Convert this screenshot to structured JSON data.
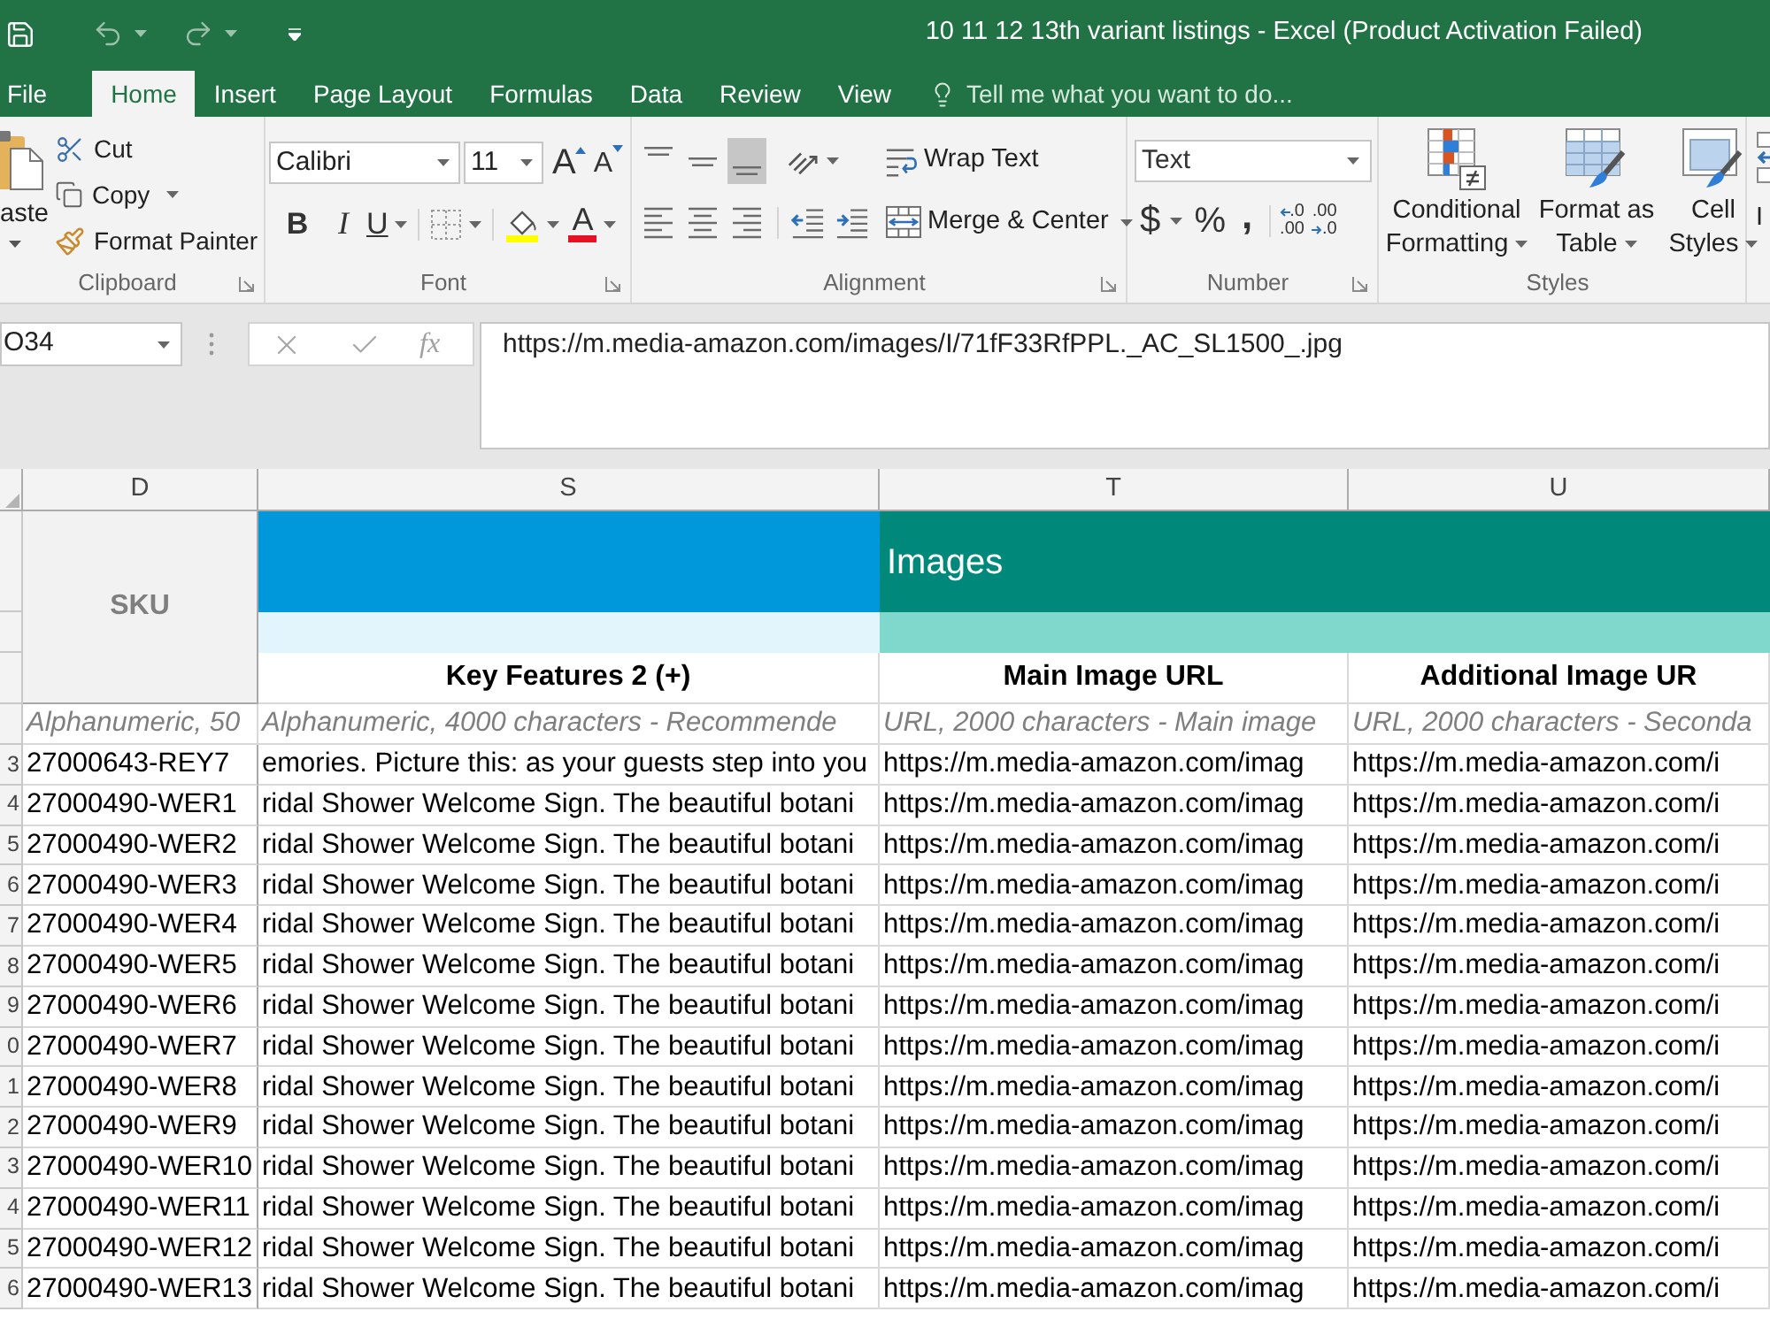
{
  "title_bar": {
    "title": "10 11 12 13th variant listings - Excel (Product Activation Failed)"
  },
  "ribbon_tabs": [
    {
      "label": "File",
      "selected": false
    },
    {
      "label": "Home",
      "selected": true
    },
    {
      "label": "Insert",
      "selected": false
    },
    {
      "label": "Page Layout",
      "selected": false
    },
    {
      "label": "Formulas",
      "selected": false
    },
    {
      "label": "Data",
      "selected": false
    },
    {
      "label": "Review",
      "selected": false
    },
    {
      "label": "View",
      "selected": false
    }
  ],
  "tell_me": {
    "placeholder": "Tell me what you want to do..."
  },
  "ribbon": {
    "clipboard": {
      "label": "Clipboard",
      "paste": "aste",
      "cut": "Cut",
      "copy": "Copy",
      "format_painter": "Format Painter"
    },
    "font": {
      "label": "Font",
      "font_name": "Calibri",
      "font_size": "11",
      "grow": "A",
      "shrink": "A",
      "bold": "B",
      "italic": "I",
      "underline": "U",
      "font_color": "A"
    },
    "alignment": {
      "label": "Alignment",
      "vertical": [
        {
          "kind": "top",
          "selected": false
        },
        {
          "kind": "middle",
          "selected": false
        },
        {
          "kind": "bottom",
          "selected": true
        }
      ],
      "horizontal": [
        {
          "kind": "left",
          "selected": false
        },
        {
          "kind": "center",
          "selected": false
        },
        {
          "kind": "right",
          "selected": false
        }
      ],
      "wrap_text": "Wrap Text",
      "merge_center": "Merge & Center"
    },
    "number": {
      "label": "Number",
      "format": "Text",
      "currency": "$",
      "percent": "%",
      "comma": ",",
      "increase_decimal": [
        ".0",
        ".00"
      ],
      "decrease_decimal": [
        ".00",
        ".0"
      ]
    },
    "styles": {
      "label": "Styles",
      "buttons": [
        {
          "kind": "conditional",
          "label": "Conditional Formatting"
        },
        {
          "kind": "table",
          "label": "Format as Table"
        },
        {
          "kind": "cell",
          "label": "Cell Styles"
        }
      ]
    },
    "cells": {
      "insert": "I"
    }
  },
  "formula_bar": {
    "name_box": "O34",
    "function": "fx",
    "formula": "https://m.media-amazon.com/images/I/71fF33RfPPL._AC_SL1500_.jpg"
  },
  "sheet": {
    "sku_column": {
      "letter": "D",
      "header": "SKU",
      "hint": "Alphanumeric, 50"
    },
    "groups": [
      {
        "color": "#0098da",
        "sub_band": {
          "color": "#e2f4fc"
        },
        "columns": [
          {
            "letter": "S",
            "header": "Key Features 2 (+)",
            "hint": "Alphanumeric, 4000 characters - Recommende"
          }
        ]
      },
      {
        "label": "Images",
        "color": "#00897b",
        "sub_band": {
          "color": "#80d7cc"
        },
        "columns": [
          {
            "letter": "T",
            "header": "Main Image URL",
            "hint": "URL, 2000 characters - Main image"
          },
          {
            "letter": "U",
            "header": "Additional Image UR",
            "hint": "URL, 2000 characters - Seconda"
          }
        ]
      }
    ],
    "rows": [
      {
        "row": "3",
        "cells": [
          "27000643-REY7",
          "emories. Picture this: as your guests step into you",
          "https://m.media-amazon.com/imag",
          "https://m.media-amazon.com/i"
        ]
      },
      {
        "row": "4",
        "cells": [
          "27000490-WER1",
          "ridal Shower Welcome Sign. The beautiful botani",
          "https://m.media-amazon.com/imag",
          "https://m.media-amazon.com/i"
        ]
      },
      {
        "row": "5",
        "cells": [
          "27000490-WER2",
          "ridal Shower Welcome Sign. The beautiful botani",
          "https://m.media-amazon.com/imag",
          "https://m.media-amazon.com/i"
        ]
      },
      {
        "row": "6",
        "cells": [
          "27000490-WER3",
          "ridal Shower Welcome Sign. The beautiful botani",
          "https://m.media-amazon.com/imag",
          "https://m.media-amazon.com/i"
        ]
      },
      {
        "row": "7",
        "cells": [
          "27000490-WER4",
          "ridal Shower Welcome Sign. The beautiful botani",
          "https://m.media-amazon.com/imag",
          "https://m.media-amazon.com/i"
        ]
      },
      {
        "row": "8",
        "cells": [
          "27000490-WER5",
          "ridal Shower Welcome Sign. The beautiful botani",
          "https://m.media-amazon.com/imag",
          "https://m.media-amazon.com/i"
        ]
      },
      {
        "row": "9",
        "cells": [
          "27000490-WER6",
          "ridal Shower Welcome Sign. The beautiful botani",
          "https://m.media-amazon.com/imag",
          "https://m.media-amazon.com/i"
        ]
      },
      {
        "row": "0",
        "cells": [
          "27000490-WER7",
          "ridal Shower Welcome Sign. The beautiful botani",
          "https://m.media-amazon.com/imag",
          "https://m.media-amazon.com/i"
        ]
      },
      {
        "row": "1",
        "cells": [
          "27000490-WER8",
          "ridal Shower Welcome Sign. The beautiful botani",
          "https://m.media-amazon.com/imag",
          "https://m.media-amazon.com/i"
        ]
      },
      {
        "row": "2",
        "cells": [
          "27000490-WER9",
          "ridal Shower Welcome Sign. The beautiful botani",
          "https://m.media-amazon.com/imag",
          "https://m.media-amazon.com/i"
        ]
      },
      {
        "row": "3",
        "cells": [
          "27000490-WER10",
          "ridal Shower Welcome Sign. The beautiful botani",
          "https://m.media-amazon.com/imag",
          "https://m.media-amazon.com/i"
        ]
      },
      {
        "row": "4",
        "cells": [
          "27000490-WER11",
          "ridal Shower Welcome Sign. The beautiful botani",
          "https://m.media-amazon.com/imag",
          "https://m.media-amazon.com/i"
        ]
      },
      {
        "row": "5",
        "cells": [
          "27000490-WER12",
          "ridal Shower Welcome Sign. The beautiful botani",
          "https://m.media-amazon.com/imag",
          "https://m.media-amazon.com/i"
        ]
      },
      {
        "row": "6",
        "cells": [
          "27000490-WER13",
          "ridal Shower Welcome Sign. The beautiful botani",
          "https://m.media-amazon.com/imag",
          "https://m.media-amazon.com/i"
        ]
      }
    ]
  }
}
